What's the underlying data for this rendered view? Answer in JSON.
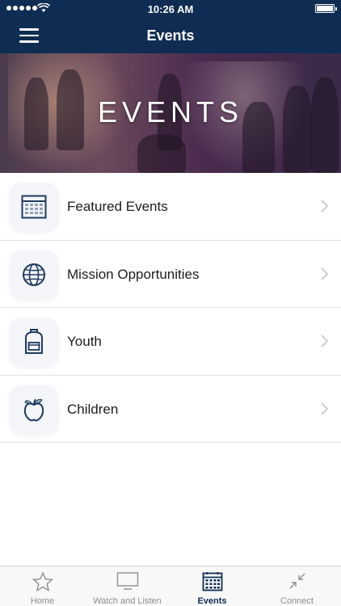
{
  "status_bar": {
    "time": "10:26 AM"
  },
  "navbar": {
    "title": "Events",
    "menu_icon": "hamburger-menu-icon"
  },
  "hero": {
    "title": "EVENTS"
  },
  "rows": [
    {
      "label": "Featured Events",
      "icon": "calendar-icon"
    },
    {
      "label": "Mission Opportunities",
      "icon": "globe-icon"
    },
    {
      "label": "Youth",
      "icon": "backpack-icon"
    },
    {
      "label": "Children",
      "icon": "apple-icon"
    }
  ],
  "tabs": [
    {
      "label": "Home",
      "icon": "star-icon",
      "active": false
    },
    {
      "label": "Watch and Listen",
      "icon": "tv-icon",
      "active": false
    },
    {
      "label": "Events",
      "icon": "calendar-icon",
      "active": true
    },
    {
      "label": "Connect",
      "icon": "connect-arrows-icon",
      "active": false
    }
  ],
  "colors": {
    "navy": "#0f2d52",
    "tab_inactive": "#8e8e93",
    "separator": "#e1e1e6"
  }
}
